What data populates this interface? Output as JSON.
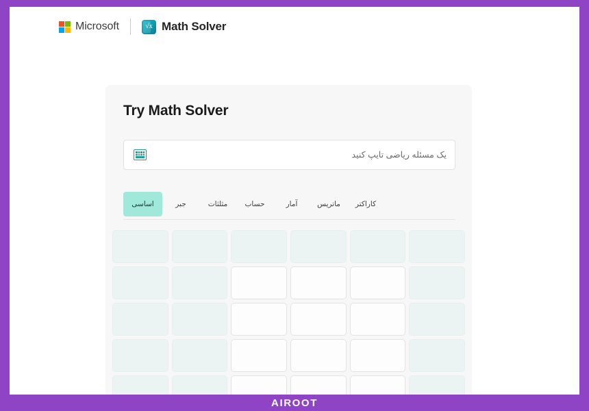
{
  "header": {
    "brand_label": "Microsoft",
    "product_label": "Math Solver",
    "product_icon": "math-solver-icon",
    "product_icon_glyph": "√x",
    "divider": "header-divider"
  },
  "card": {
    "title": "Try Math Solver"
  },
  "search": {
    "value": "",
    "placeholder": "یک مسئله ریاضی تایپ کنید",
    "keyboard_icon": "keyboard-icon"
  },
  "tabs": [
    {
      "label": "اساسی",
      "name": "tab-basic",
      "active": true
    },
    {
      "label": "جبر",
      "name": "tab-algebra",
      "active": false
    },
    {
      "label": "مثلثات",
      "name": "tab-trigonometry",
      "active": false
    },
    {
      "label": "حساب",
      "name": "tab-calculus",
      "active": false
    },
    {
      "label": "آمار",
      "name": "tab-statistics",
      "active": false
    },
    {
      "label": "ماتریس",
      "name": "tab-matrix",
      "active": false
    },
    {
      "label": "کاراکتر",
      "name": "tab-character",
      "active": false
    }
  ],
  "keypad": {
    "columns": 6,
    "rows": 5,
    "tint_columns": [
      1,
      2,
      6
    ],
    "row1_all_tint": true,
    "keys": [
      [
        "",
        "",
        "",
        "",
        "",
        ""
      ],
      [
        "",
        "",
        "",
        "",
        "",
        ""
      ],
      [
        "",
        "",
        "",
        "",
        "",
        ""
      ],
      [
        "",
        "",
        "",
        "",
        "",
        ""
      ],
      [
        "",
        "",
        "",
        "",
        "",
        ""
      ]
    ]
  },
  "watermark": {
    "text": "AIROOT"
  },
  "colors": {
    "frame_purple": "#8e44c4",
    "accent_mint": "#9fe8da",
    "teal_icon": "#1f9c9c",
    "card_bg": "#f7f7f8",
    "key_tint": "#ecf4f3"
  }
}
